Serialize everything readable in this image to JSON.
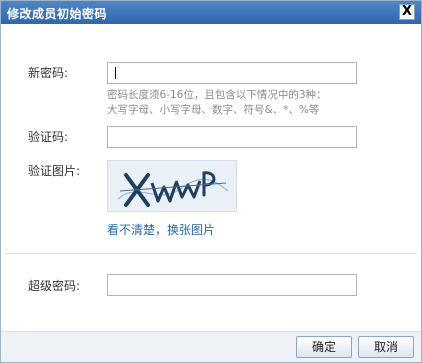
{
  "dialog": {
    "title": "修改成员初始密码",
    "close_label": "X"
  },
  "form": {
    "new_password_label": "新密码:",
    "new_password_value": "",
    "password_hint_line1": "密码长度须6-16位，且包含以下情况中的3种：",
    "password_hint_line2": "大写字母、小写字母、数字、符号&、*、%等",
    "captcha_label": "验证码:",
    "captcha_value": "",
    "captcha_image_label": "验证图片:",
    "captcha_image_text": "XWWP",
    "refresh_captcha_link": "看不清楚，换张图片",
    "super_password_label": "超级密码:",
    "super_password_value": ""
  },
  "footer": {
    "ok_label": "确定",
    "cancel_label": "取消"
  }
}
